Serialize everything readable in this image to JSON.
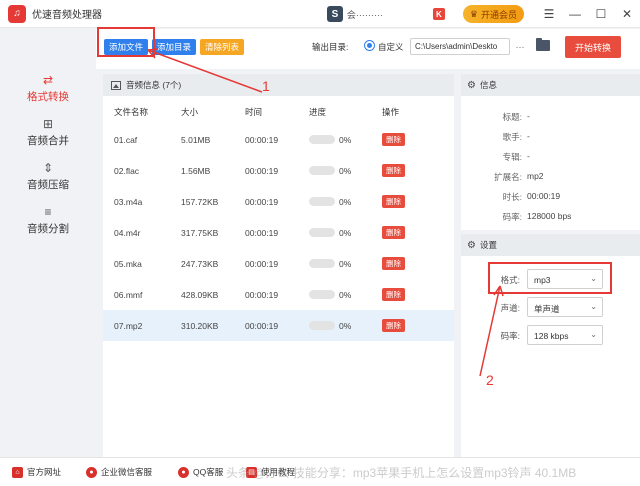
{
  "app": {
    "title": "优速音频处理器",
    "logo_text": "♫"
  },
  "titlebar": {
    "user_avatar_letter": "S",
    "user_name": "会·········",
    "k_badge": "K",
    "vip_label": "开通会员",
    "menu_icon": "hamburger-icon",
    "minimize": "—",
    "maximize": "☐",
    "close": "✕"
  },
  "nav": {
    "items": [
      {
        "label": "格式转换",
        "icon": "⇄",
        "active": true
      },
      {
        "label": "音频合并",
        "icon": "⊞",
        "active": false
      },
      {
        "label": "音频压缩",
        "icon": "⇕",
        "active": false
      },
      {
        "label": "音频分割",
        "icon": "≡",
        "active": false
      }
    ]
  },
  "toolbar": {
    "add_file": "添加文件",
    "add_dir": "添加目录",
    "clear_list": "清除列表",
    "output_label": "输出目录:",
    "custom_label": "自定义",
    "output_path": "C:\\Users\\admin\\Deskto",
    "more": "···",
    "start_convert": "开始转换"
  },
  "file_panel": {
    "header": "音频信息 (7个)",
    "columns": [
      "文件名称",
      "大小",
      "时间",
      "进度",
      "操作"
    ],
    "rows": [
      {
        "name": "01.caf",
        "size": "5.01MB",
        "time": "00:00:19",
        "progress": "0%",
        "progress_value": 0,
        "action": "删除"
      },
      {
        "name": "02.flac",
        "size": "1.56MB",
        "time": "00:00:19",
        "progress": "0%",
        "progress_value": 0,
        "action": "删除"
      },
      {
        "name": "03.m4a",
        "size": "157.72KB",
        "time": "00:00:19",
        "progress": "0%",
        "progress_value": 0,
        "action": "删除"
      },
      {
        "name": "04.m4r",
        "size": "317.75KB",
        "time": "00:00:19",
        "progress": "0%",
        "progress_value": 0,
        "action": "删除"
      },
      {
        "name": "05.mka",
        "size": "247.73KB",
        "time": "00:00:19",
        "progress": "0%",
        "progress_value": 0,
        "action": "删除"
      },
      {
        "name": "06.mmf",
        "size": "428.09KB",
        "time": "00:00:19",
        "progress": "0%",
        "progress_value": 0,
        "action": "删除"
      },
      {
        "name": "07.mp2",
        "size": "310.20KB",
        "time": "00:00:19",
        "progress": "0%",
        "progress_value": 0,
        "action": "删除"
      }
    ]
  },
  "info_panel": {
    "header": "信息",
    "fields": [
      {
        "key": "标题:",
        "value": "-"
      },
      {
        "key": "歌手:",
        "value": "-"
      },
      {
        "key": "专辑:",
        "value": "-"
      },
      {
        "key": "扩展名:",
        "value": "mp2"
      },
      {
        "key": "时长:",
        "value": "00:00:19"
      },
      {
        "key": "码率:",
        "value": "128000 bps"
      }
    ]
  },
  "settings_panel": {
    "header": "设置",
    "format_label": "格式:",
    "format_value": "mp3",
    "channel_label": "声道:",
    "channel_value": "单声道",
    "bitrate_label": "码率:",
    "bitrate_value": "128 kbps"
  },
  "footer": {
    "site": "官方网址",
    "wechat": "企业微信客服",
    "qq": "QQ客服",
    "tutorial": "使用教程",
    "watermark": "头条 @办公 技能分享：mp3苹果手机上怎么设置mp3铃声 40.1MB"
  },
  "annotations": {
    "label_1": "1",
    "label_2": "2"
  },
  "colors": {
    "accent_red": "#e53935",
    "button_blue": "#2f80ed",
    "button_orange": "#f5a623",
    "delete_red": "#e74c3c",
    "selected_row": "#e6f1fb"
  }
}
